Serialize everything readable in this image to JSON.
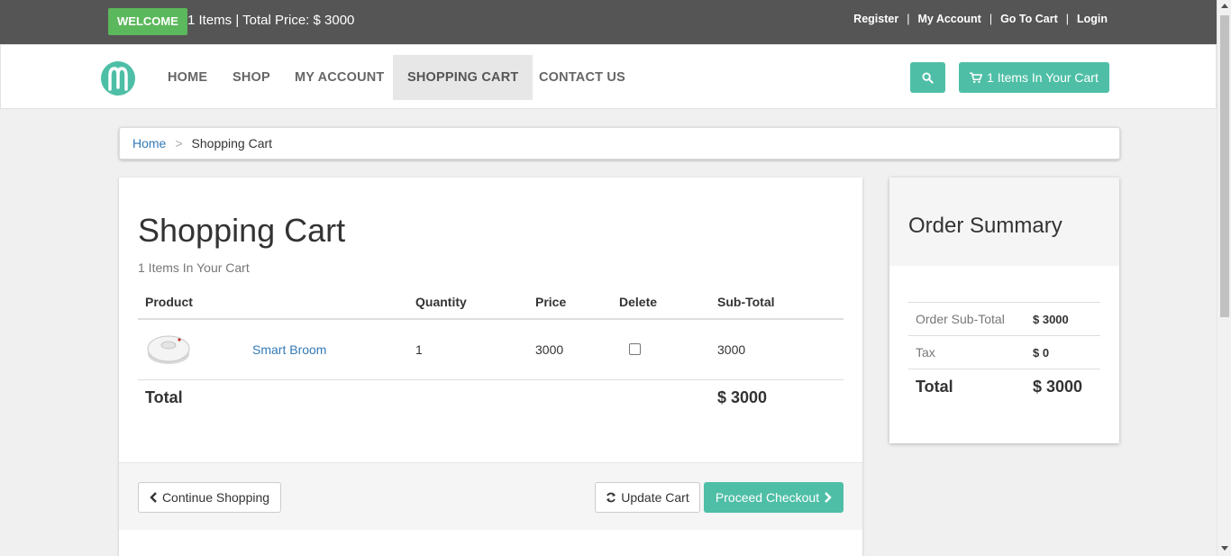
{
  "topbar": {
    "welcome": "WELCOME",
    "cart_info": "1 Items | Total Price: $ 3000",
    "links": [
      "Register",
      "My Account",
      "Go To Cart",
      "Login"
    ]
  },
  "nav": {
    "items": [
      "HOME",
      "SHOP",
      "MY ACCOUNT",
      "SHOPPING CART",
      "CONTACT US"
    ],
    "active": "SHOPPING CART",
    "cart_button": "1 Items In Your Cart",
    "accent_color": "#4ebfa6"
  },
  "breadcrumb": {
    "home": "Home",
    "separator": ">",
    "current": "Shopping Cart"
  },
  "cart": {
    "title": "Shopping Cart",
    "subtitle": "1 Items In Your Cart",
    "headers": [
      "Product",
      "",
      "Quantity",
      "Price",
      "Delete",
      "Sub-Total"
    ],
    "rows": [
      {
        "name": "Smart Broom",
        "quantity": "1",
        "price": "3000",
        "subtotal": "3000"
      }
    ],
    "total_label": "Total",
    "total_value": "$ 3000",
    "buttons": {
      "continue": "Continue Shopping",
      "update": "Update Cart",
      "checkout": "Proceed Checkout"
    }
  },
  "summary": {
    "title": "Order Summary",
    "rows": [
      {
        "label": "Order Sub-Total",
        "value": "$ 3000"
      },
      {
        "label": "Tax",
        "value": "$ 0"
      }
    ],
    "total_label": "Total",
    "total_value": "$ 3000"
  }
}
